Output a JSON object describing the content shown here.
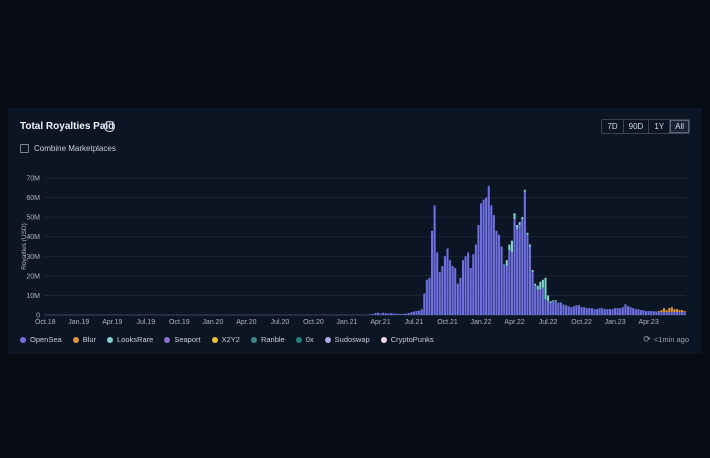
{
  "header": {
    "title": "Total Royalties Paid",
    "info_icon": "info-icon"
  },
  "ranges": [
    {
      "label": "7D",
      "active": false
    },
    {
      "label": "90D",
      "active": false
    },
    {
      "label": "1Y",
      "active": false
    },
    {
      "label": "All",
      "active": true
    }
  ],
  "combine": {
    "label": "Combine Marketplaces",
    "checked": false
  },
  "status": {
    "updated": "<1min ago",
    "icon": "refresh-icon"
  },
  "legend": [
    {
      "label": "OpenSea",
      "color": "#6f70e2"
    },
    {
      "label": "Blur",
      "color": "#e0973a"
    },
    {
      "label": "LooksRare",
      "color": "#7fd3cf"
    },
    {
      "label": "Seaport",
      "color": "#8f6fd0"
    },
    {
      "label": "X2Y2",
      "color": "#e8c43a"
    },
    {
      "label": "Rarible",
      "color": "#3c8b8a"
    },
    {
      "label": "0x",
      "color": "#2e7d7c"
    },
    {
      "label": "Sudoswap",
      "color": "#a9b0ea"
    },
    {
      "label": "CryptoPunks",
      "color": "#f3d9ec"
    }
  ],
  "chart_data": {
    "type": "bar",
    "title": "Total Royalties Paid",
    "ylabel": "Royalties (USD)",
    "xlabel": "",
    "ylim": [
      0,
      70000000
    ],
    "y_ticks": [
      "0",
      "10M",
      "20M",
      "30M",
      "40M",
      "50M",
      "60M",
      "70M"
    ],
    "x_ticks": [
      "Oct.18",
      "Jan.19",
      "Apr.19",
      "Jul.19",
      "Oct.19",
      "Jan.20",
      "Apr.20",
      "Jul.20",
      "Oct.20",
      "Jan.21",
      "Apr.21",
      "Jul.21",
      "Oct.21",
      "Jan.22",
      "Apr.22",
      "Jul.22",
      "Oct.22",
      "Jan.23",
      "Apr.23"
    ],
    "legend_position": "bottom",
    "grid": true,
    "stacked": true,
    "x_start": "2018-10-01",
    "interval": "weekly",
    "series": [
      {
        "name": "OpenSea",
        "color": "#6f70e2",
        "values": [
          0.1,
          0.1,
          0.1,
          0.1,
          0.1,
          0.1,
          0.1,
          0.1,
          0.1,
          0.1,
          0.1,
          0.1,
          0.1,
          0.1,
          0.1,
          0.1,
          0.1,
          0.1,
          0.1,
          0.1,
          0.1,
          0.1,
          0.1,
          0.1,
          0.1,
          0.1,
          0.1,
          0.1,
          0.1,
          0.1,
          0.1,
          0.1,
          0.1,
          0.1,
          0.1,
          0.1,
          0.1,
          0.1,
          0.1,
          0.1,
          0.1,
          0.1,
          0.1,
          0.1,
          0.1,
          0.1,
          0.1,
          0.1,
          0.1,
          0.1,
          0.1,
          0.1,
          0.1,
          0.1,
          0.1,
          0.1,
          0.1,
          0.1,
          0.1,
          0.1,
          0.1,
          0.1,
          0.1,
          0.1,
          0.1,
          0.1,
          0.1,
          0.1,
          0.1,
          0.1,
          0.1,
          0.1,
          0.1,
          0.1,
          0.1,
          0.1,
          0.1,
          0.1,
          0.1,
          0.1,
          0.1,
          0.1,
          0.1,
          0.1,
          0.1,
          0.1,
          0.1,
          0.1,
          0.1,
          0.1,
          0.1,
          0.1,
          0.1,
          0.1,
          0.1,
          0.1,
          0.1,
          0.1,
          0.1,
          0.1,
          0.1,
          0.1,
          0.1,
          0.1,
          0.1,
          0.1,
          0.1,
          0.1,
          0.1,
          0.1,
          0.1,
          0.1,
          0.1,
          0.1,
          0.1,
          0.1,
          0.1,
          0.1,
          0.1,
          0.1,
          0.1,
          0.1,
          0.1,
          0.1,
          0.1,
          0.1,
          0.3,
          0.5,
          1.0,
          1.2,
          0.8,
          1.1,
          0.9,
          0.7,
          1.0,
          0.8,
          0.6,
          0.7,
          0.5,
          0.6,
          0.8,
          1.0,
          1.5,
          1.8,
          2.0,
          2.2,
          3.0,
          11.0,
          18.0,
          19.0,
          43.0,
          56.0,
          32.0,
          22.0,
          25.0,
          30.0,
          34.0,
          28.0,
          25.0,
          24.0,
          16.0,
          19.0,
          28.0,
          30.0,
          32.0,
          24.0,
          31.0,
          36.0,
          46.0,
          57.0,
          59.0,
          60.0,
          66.0,
          56.0,
          51.0,
          43.0,
          41.0,
          35.0,
          26.0,
          25.0,
          33.0,
          32.0,
          49.0,
          44.0,
          46.0,
          49.0,
          63.0,
          41.0,
          35.0,
          22.0,
          15.0,
          13.0,
          13.0,
          14.0,
          8.0,
          7.0,
          6.0,
          7.0,
          7.0,
          6.0,
          6.0,
          5.0,
          5.0,
          4.5,
          4.0,
          4.5,
          5.0,
          5.0,
          4.0,
          4.0,
          3.5,
          3.5,
          3.5,
          3.0,
          3.0,
          3.5,
          3.5,
          3.0,
          3.0,
          3.0,
          3.0,
          3.5,
          3.5,
          3.5,
          4.0,
          5.5,
          4.5,
          4.0,
          3.5,
          3.0,
          3.0,
          2.5,
          2.5,
          2.0,
          2.0,
          2.0,
          2.0,
          1.8,
          1.5,
          1.5,
          1.5,
          1.5,
          1.5,
          1.5,
          1.5,
          1.5,
          1.5,
          1.5,
          1.5
        ]
      },
      {
        "name": "LooksRare",
        "color": "#7fd3cf",
        "values": [
          0,
          0,
          0,
          0,
          0,
          0,
          0,
          0,
          0,
          0,
          0,
          0,
          0,
          0,
          0,
          0,
          0,
          0,
          0,
          0,
          0,
          0,
          0,
          0,
          0,
          0,
          0,
          0,
          0,
          0,
          0,
          0,
          0,
          0,
          0,
          0,
          0,
          0,
          0,
          0,
          0,
          0,
          0,
          0,
          0,
          0,
          0,
          0,
          0,
          0,
          0,
          0,
          0,
          0,
          0,
          0,
          0,
          0,
          0,
          0,
          0,
          0,
          0,
          0,
          0,
          0,
          0,
          0,
          0,
          0,
          0,
          0,
          0,
          0,
          0,
          0,
          0,
          0,
          0,
          0,
          0,
          0,
          0,
          0,
          0,
          0,
          0,
          0,
          0,
          0,
          0,
          0,
          0,
          0,
          0,
          0,
          0,
          0,
          0,
          0,
          0,
          0,
          0,
          0,
          0,
          0,
          0,
          0,
          0,
          0,
          0,
          0,
          0,
          0,
          0,
          0,
          0,
          0,
          0,
          0,
          0,
          0,
          0,
          0,
          0,
          0,
          0,
          0,
          0,
          0,
          0,
          0,
          0,
          0,
          0,
          0,
          0,
          0,
          0,
          0,
          0,
          0,
          0,
          0,
          0,
          0,
          0,
          0,
          0,
          0,
          0,
          0,
          0,
          0,
          0,
          0,
          0,
          0,
          0,
          0,
          0,
          0,
          0,
          0,
          0,
          0,
          0,
          0,
          0,
          0,
          0,
          0,
          0,
          0,
          0,
          0,
          0,
          0,
          0,
          3.0,
          3.0,
          6.0,
          3.0,
          2.0,
          1.5,
          1.0,
          1.0,
          1.0,
          1.0,
          1.0,
          1.0,
          2.0,
          4.0,
          4.0,
          11.0,
          3.0,
          1.0,
          0.5,
          0.5,
          0.3,
          0.3,
          0.3,
          0,
          0,
          0,
          0,
          0,
          0,
          0,
          0,
          0,
          0,
          0,
          0,
          0,
          0,
          0,
          0,
          0,
          0,
          0,
          0,
          0,
          0,
          0,
          0,
          0,
          0,
          0,
          0,
          0,
          0,
          0,
          0,
          0,
          0,
          0,
          0,
          0,
          0,
          0,
          0,
          0,
          0,
          0,
          0,
          0,
          0,
          0,
          0,
          0,
          0,
          0,
          0,
          0,
          0,
          0
        ]
      },
      {
        "name": "Blur",
        "color": "#e0973a",
        "values": [
          0,
          0,
          0,
          0,
          0,
          0,
          0,
          0,
          0,
          0,
          0,
          0,
          0,
          0,
          0,
          0,
          0,
          0,
          0,
          0,
          0,
          0,
          0,
          0,
          0,
          0,
          0,
          0,
          0,
          0,
          0,
          0,
          0,
          0,
          0,
          0,
          0,
          0,
          0,
          0,
          0,
          0,
          0,
          0,
          0,
          0,
          0,
          0,
          0,
          0,
          0,
          0,
          0,
          0,
          0,
          0,
          0,
          0,
          0,
          0,
          0,
          0,
          0,
          0,
          0,
          0,
          0,
          0,
          0,
          0,
          0,
          0,
          0,
          0,
          0,
          0,
          0,
          0,
          0,
          0,
          0,
          0,
          0,
          0,
          0,
          0,
          0,
          0,
          0,
          0,
          0,
          0,
          0,
          0,
          0,
          0,
          0,
          0,
          0,
          0,
          0,
          0,
          0,
          0,
          0,
          0,
          0,
          0,
          0,
          0,
          0,
          0,
          0,
          0,
          0,
          0,
          0,
          0,
          0,
          0,
          0,
          0,
          0,
          0,
          0,
          0,
          0,
          0,
          0,
          0,
          0,
          0,
          0,
          0,
          0,
          0,
          0,
          0,
          0,
          0,
          0,
          0,
          0,
          0,
          0,
          0,
          0,
          0,
          0,
          0,
          0,
          0,
          0,
          0,
          0,
          0,
          0,
          0,
          0,
          0,
          0,
          0,
          0,
          0,
          0,
          0,
          0,
          0,
          0,
          0,
          0,
          0,
          0,
          0,
          0,
          0,
          0,
          0,
          0,
          0,
          0,
          0,
          0,
          0,
          0,
          0,
          0,
          0,
          0,
          0,
          0,
          0,
          0,
          0,
          0,
          0,
          0,
          0,
          0,
          0,
          0,
          0,
          0,
          0,
          0,
          0,
          0,
          0,
          0,
          0,
          0,
          0,
          0,
          0,
          0,
          0,
          0,
          0,
          0,
          0,
          0,
          0,
          0,
          0,
          0,
          0,
          0,
          0,
          0,
          0,
          0,
          0,
          0,
          0,
          0,
          0,
          0,
          0,
          0.5,
          1.0,
          2.0,
          1.0,
          2.0,
          2.5,
          1.5,
          1.5,
          1.0,
          1.0,
          0.5,
          0.5,
          0.5,
          0.5,
          0.5,
          0.5,
          0.3,
          0.3,
          0.3,
          0.3,
          0.3,
          0.3,
          1.5,
          1.0
        ]
      }
    ]
  }
}
